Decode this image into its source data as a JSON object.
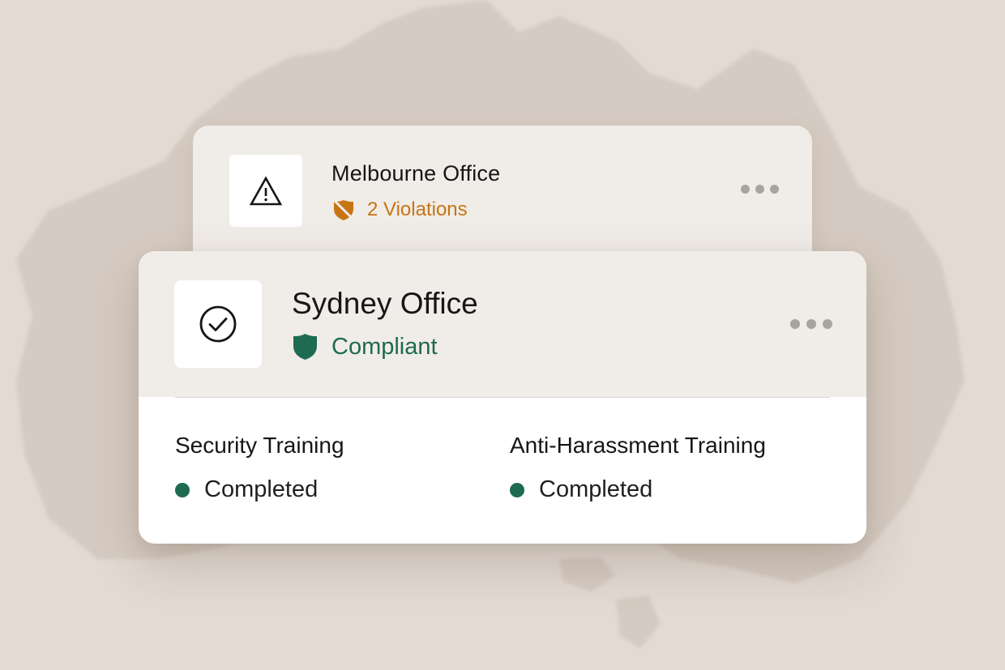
{
  "colors": {
    "background": "#e2dad3",
    "map": "#d6cbc2",
    "card_header": "#f0ece8",
    "violation": "#c87413",
    "compliant": "#1e6b52"
  },
  "offices": [
    {
      "name": "Melbourne Office",
      "status": "2 Violations",
      "status_icon": "shield-off-icon",
      "icon": "warning-triangle-icon"
    },
    {
      "name": "Sydney Office",
      "status": "Compliant",
      "status_icon": "shield-icon",
      "icon": "check-circle-icon",
      "trainings": [
        {
          "title": "Security Training",
          "status": "Completed"
        },
        {
          "title": "Anti-Harassment Training",
          "status": "Completed"
        }
      ]
    }
  ]
}
